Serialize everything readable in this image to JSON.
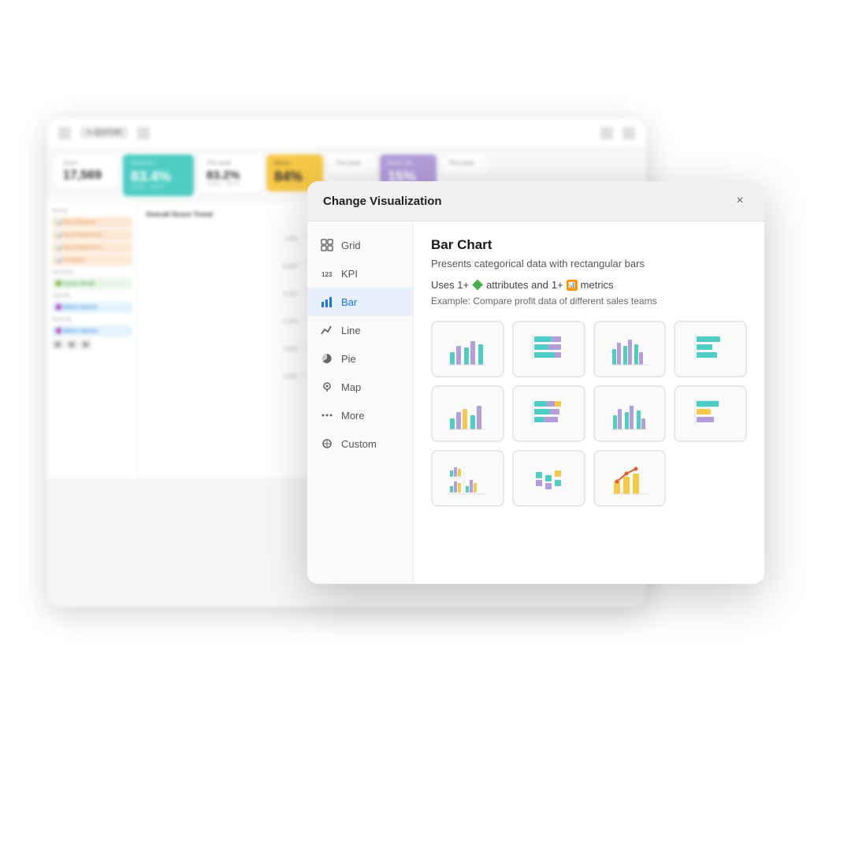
{
  "dashboard": {
    "title": "Overall Score Trend",
    "metrics": [
      {
        "label": "Score ...",
        "value": "17,569",
        "style": "plain"
      },
      {
        "label": "Score Av...",
        "value": "83.4%",
        "sub": "Previo...: 84.1%",
        "style": "teal"
      },
      {
        "label": "This week",
        "value": "83.2%",
        "sub": "Previo...: 84.1%",
        "style": "plain"
      },
      {
        "label": "Above ...",
        "value": "84%",
        "style": "yellow"
      },
      {
        "label": "This week",
        "value": "",
        "style": "plain"
      },
      {
        "label": "Below Tar...",
        "value": "15%",
        "style": "purple"
      },
      {
        "label": "This week",
        "value": "",
        "style": "plain"
      }
    ]
  },
  "modal": {
    "title": "Change Visualization",
    "close_label": "×",
    "nav_items": [
      {
        "id": "grid",
        "label": "Grid",
        "icon": "⊞"
      },
      {
        "id": "kpi",
        "label": "KPI",
        "icon": "123"
      },
      {
        "id": "bar",
        "label": "Bar",
        "icon": "▦",
        "active": true
      },
      {
        "id": "line",
        "label": "Line",
        "icon": "∿"
      },
      {
        "id": "pie",
        "label": "Pie",
        "icon": "◑"
      },
      {
        "id": "map",
        "label": "Map",
        "icon": "⊙"
      },
      {
        "id": "more",
        "label": "More",
        "icon": "···"
      },
      {
        "id": "custom",
        "label": "Custom",
        "icon": "✦"
      }
    ],
    "chart_type": {
      "title": "Bar Chart",
      "description": "Presents categorical data with rectangular bars",
      "requirements": "Uses 1+ attributes and 1+ metrics",
      "example": "Example: Compare profit data of different sales teams"
    },
    "variants": [
      {
        "id": "v1",
        "type": "bar-vertical-grouped",
        "selected": false
      },
      {
        "id": "v2",
        "type": "bar-horizontal-stacked",
        "selected": false
      },
      {
        "id": "v3",
        "type": "bar-vertical-side",
        "selected": false
      },
      {
        "id": "v4",
        "type": "bar-horizontal-plain",
        "selected": false
      },
      {
        "id": "v5",
        "type": "bar-vertical-grouped-2",
        "selected": false
      },
      {
        "id": "v6",
        "type": "bar-horizontal-stacked-2",
        "selected": false
      },
      {
        "id": "v7",
        "type": "bar-vertical-grouped-3",
        "selected": false
      },
      {
        "id": "v8",
        "type": "bar-horizontal-plain-2",
        "selected": false
      },
      {
        "id": "v9",
        "type": "bar-small-multi",
        "selected": false
      },
      {
        "id": "v10",
        "type": "scatter-dot",
        "selected": false
      },
      {
        "id": "v11",
        "type": "bar-line-combo",
        "selected": false
      }
    ]
  }
}
